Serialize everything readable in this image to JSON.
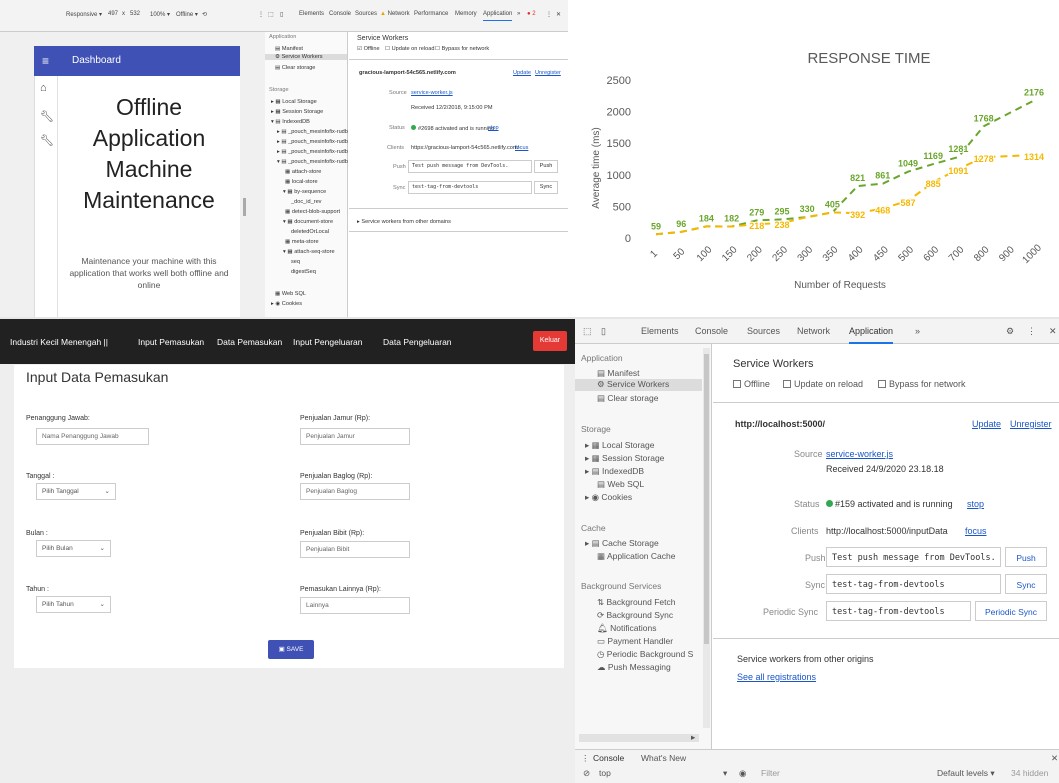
{
  "panelA": {
    "devtools_bar": {
      "responsive": "Responsive ▾",
      "w": "497",
      "x": "x",
      "h": "532",
      "zoom": "100% ▾",
      "throttle": "Offline ▾",
      "tabs": [
        "Elements",
        "Console",
        "Sources",
        "Network",
        "Performance",
        "Memory",
        "Application"
      ],
      "more": "»",
      "errors": "2",
      "menu": "⋮",
      "close": "✕"
    },
    "app": {
      "bar_title": "Dashboard",
      "heading_lines": [
        "Offline",
        "Application",
        "Machine",
        "Maintenance"
      ],
      "description": "Maintenance your machine with this application that works well both offline and online"
    },
    "sidebar": {
      "app_head": "Application",
      "manifest": "Manifest",
      "service_workers": "Service Workers",
      "clear_storage": "Clear storage",
      "storage_head": "Storage",
      "items": [
        "▸ ▦ Local Storage",
        "▸ ▦ Session Storage",
        "▾ ▤ IndexedDB",
        "▸ ▤ _pouch_mesinfofix-rudb",
        "▸ ▤ _pouch_mesinfofix-rudb",
        "▸ ▤ _pouch_mesinfofix-rudb",
        "▾ ▤ _pouch_mesinfofix-rudb",
        "▦ attach-store",
        "▦ local-store",
        "▾ ▦ by-sequence",
        "_doc_id_rev",
        "▦ detect-blob-support",
        "▾ ▦ document-store",
        "deletedOrLocal",
        "▦ meta-store",
        "▾ ▦ attach-seq-store",
        "seq",
        "digestSeq",
        "▦ Web SQL",
        "▸ ◉ Cookies"
      ]
    },
    "sw": {
      "title": "Service Workers",
      "offline": "Offline",
      "update_on_reload": "Update on reload",
      "bypass": "Bypass for network",
      "origin": "gracious-lamport-54c565.netlify.com",
      "update": "Update",
      "unregister": "Unregister",
      "source_label": "Source",
      "source_link": "service-worker.js",
      "received": "Received 12/2/2018, 9:15:00 PM",
      "status_label": "Status",
      "status_text": "#2698 activated and is running",
      "stop": "stop",
      "clients_label": "Clients",
      "clients_text": "https://gracious-lamport-54c565.netlify.com/",
      "focus": "focus",
      "push_label": "Push",
      "push_value": "Test push message from DevTools.",
      "push_btn": "Push",
      "sync_label": "Sync",
      "sync_value": "test-tag-from-devtools",
      "sync_btn": "Sync",
      "other": "Service workers from other domains"
    }
  },
  "panelB": {
    "chart_data": {
      "type": "line",
      "title": "RESPONSE TIME",
      "xlabel": "Number of Requests",
      "ylabel": "Average time (ms)",
      "ylim": [
        0,
        2500
      ],
      "yticks": [
        0,
        500,
        1000,
        1500,
        2000,
        2500
      ],
      "grid": false,
      "legend": "none",
      "categories": [
        "1",
        "50",
        "100",
        "150",
        "200",
        "250",
        "300",
        "350",
        "400",
        "450",
        "500",
        "600",
        "700",
        "800",
        "900",
        "1000"
      ],
      "series": [
        {
          "color": "#6aa62c",
          "values": [
            59,
            96,
            184,
            182,
            279,
            295,
            330,
            405,
            821,
            861,
            1049,
            1169,
            1281,
            1768,
            null,
            2176
          ],
          "labels": [
            "59",
            "96",
            "184",
            "182",
            "279",
            "295",
            "330",
            "405",
            "821",
            "861",
            "1049",
            "1169",
            "1281",
            "1768",
            "",
            "2176"
          ]
        },
        {
          "color": "#f5b800",
          "values": [
            59,
            96,
            184,
            182,
            218,
            238,
            330,
            405,
            392,
            468,
            587,
            885,
            1091,
            1278,
            null,
            1314
          ],
          "labels": [
            "",
            "",
            "",
            "",
            "218",
            "238",
            "",
            "",
            "392",
            "468",
            "587",
            "885",
            "1091",
            "1278",
            "",
            "1314"
          ]
        }
      ]
    }
  },
  "panelC": {
    "nav": {
      "brand": "Industri Kecil Menengah ||",
      "links": [
        "Input Pemasukan",
        "Data Pemasukan",
        "Input Pengeluaran",
        "Data Pengeluaran"
      ],
      "logout": "Keluar"
    },
    "form_title": "Input Data Pemasukan",
    "left_fields": [
      {
        "label": "Penanggung Jawab:",
        "placeholder": "Nama Penanggung Jawab"
      },
      {
        "label": "Tanggal :",
        "select": "Pilih Tanggal"
      },
      {
        "label": "Bulan :",
        "select": "Pilih Bulan"
      },
      {
        "label": "Tahun :",
        "select": "Pilih Tahun"
      }
    ],
    "right_fields": [
      {
        "label": "Penjualan Jamur (Rp):",
        "placeholder": "Penjualan Jamur"
      },
      {
        "label": "Penjualan Baglog (Rp):",
        "placeholder": "Penjualan Baglog"
      },
      {
        "label": "Penjualan Bibit (Rp):",
        "placeholder": "Penjualan Bibit"
      },
      {
        "label": "Pemasukan Lainnya (Rp):",
        "placeholder": "Lainnya"
      }
    ],
    "save": "SAVE"
  },
  "panelD": {
    "toolbar": {
      "tabs": [
        "Elements",
        "Console",
        "Sources",
        "Network",
        "Application"
      ],
      "more": "»",
      "menu": "⋮",
      "close": "✕"
    },
    "sidebar": {
      "app_head": "Application",
      "manifest": "Manifest",
      "service_workers": "Service Workers",
      "clear_storage": "Clear storage",
      "storage_head": "Storage",
      "storage_items": [
        "Local Storage",
        "Session Storage",
        "IndexedDB",
        "Web SQL",
        "Cookies"
      ],
      "cache_head": "Cache",
      "cache_items": [
        "Cache Storage",
        "Application Cache"
      ],
      "bg_head": "Background Services",
      "bg_items": [
        "Background Fetch",
        "Background Sync",
        "Notifications",
        "Payment Handler",
        "Periodic Background S",
        "Push Messaging"
      ]
    },
    "sw": {
      "title": "Service Workers",
      "offline": "Offline",
      "update_on_reload": "Update on reload",
      "bypass": "Bypass for network",
      "origin": "http://localhost:5000/",
      "update": "Update",
      "unregister": "Unregister",
      "source_label": "Source",
      "source_link": "service-worker.js",
      "received": "Received 24/9/2020 23.18.18",
      "status_label": "Status",
      "status_text": "#159 activated and is running",
      "stop": "stop",
      "clients_label": "Clients",
      "clients_text": "http://localhost:5000/inputData",
      "focus": "focus",
      "push_label": "Push",
      "push_value": "Test push message from DevTools.",
      "push_btn": "Push",
      "sync_label": "Sync",
      "sync_value": "test-tag-from-devtools",
      "sync_btn": "Sync",
      "periodic_label": "Periodic Sync",
      "periodic_value": "test-tag-from-devtools",
      "periodic_btn": "Periodic Sync",
      "other_title": "Service workers from other origins",
      "see_all": "See all registrations"
    },
    "drawer": {
      "tabs": [
        "Console",
        "What's New"
      ],
      "context": "top",
      "filter": "Filter",
      "levels": "Default levels ▾",
      "hidden": "34 hidden"
    }
  }
}
